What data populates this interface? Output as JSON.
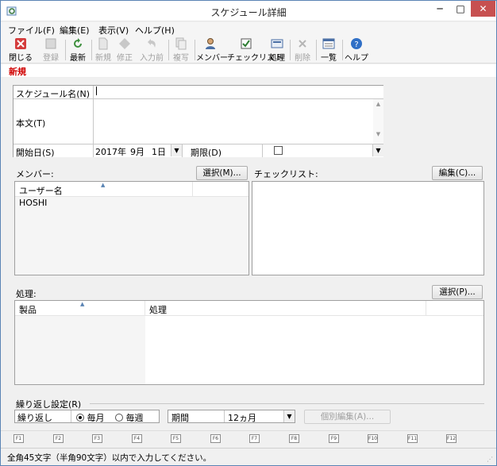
{
  "window": {
    "title": "スケジュール詳細",
    "min_glyph": "─",
    "max_glyph": "□",
    "close_glyph": "✕"
  },
  "menu": [
    "ファイル(F)",
    "編集(E)",
    "表示(V)",
    "ヘルプ(H)"
  ],
  "toolbar": {
    "close": "閉じる",
    "register": "登録",
    "refresh": "最新",
    "new": "新規",
    "edit": "修正",
    "prev_input": "入力前",
    "copy": "複写",
    "member": "メンバー",
    "checklist": "チェックリスト",
    "process": "処理",
    "delete": "削除",
    "list": "一覧",
    "help": "ヘルプ"
  },
  "mode_label": "新規",
  "form": {
    "schedule_name_label": "スケジュール名(N)",
    "schedule_name_value": "",
    "body_label": "本文(T)",
    "start_date_label": "開始日(S)",
    "start_year": "2017年",
    "start_month": "9月",
    "start_day": "1日",
    "deadline_label": "期限(D)"
  },
  "members": {
    "label": "メンバー:",
    "select_button": "選択(M)...",
    "column_header": "ユーザー名",
    "rows": [
      "HOSHI"
    ]
  },
  "checklist": {
    "label": "チェックリスト:",
    "edit_button": "編集(C)..."
  },
  "processing": {
    "label": "処理:",
    "select_button": "選択(P)...",
    "col_product": "製品",
    "col_process": "処理"
  },
  "repeat": {
    "section_label": "繰り返し設定(R)",
    "repeat_label": "繰り返し",
    "monthly": "毎月",
    "weekly": "毎週",
    "selected": "monthly",
    "period_label": "期間",
    "period_value": "12ヵ月",
    "individual_edit": "個別編集(A)..."
  },
  "fkeys": [
    "F1",
    "F2",
    "F3",
    "F4",
    "F5",
    "F6",
    "F7",
    "F8",
    "F9",
    "F10",
    "F11",
    "F12"
  ],
  "status": "全角45文字（半角90文字）以内で入力してください。",
  "colors": {
    "accent": "#d00000",
    "close_button": "#c75050",
    "border": "#a0a0a0"
  }
}
